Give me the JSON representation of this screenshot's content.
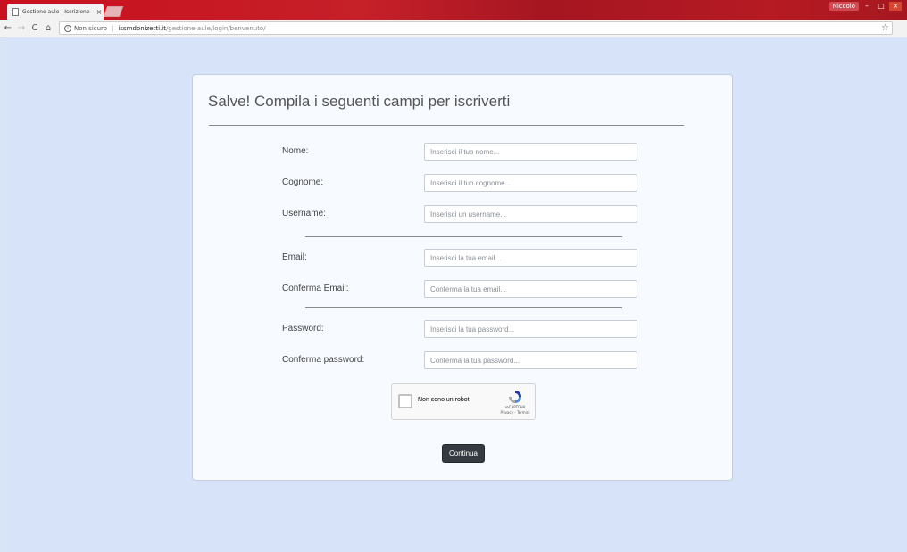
{
  "browser": {
    "tab_title": "Gestione aule | Iscrizione",
    "tab_close": "×",
    "user_name": "Niccolo",
    "win_minimize": "–",
    "win_maximize": "□",
    "win_close": "×",
    "back_icon": "←",
    "forward_icon": "→",
    "reload_icon": "C",
    "home_icon": "⌂",
    "info_icon": "i",
    "not_secure": "Non sicuro",
    "url_host": "issmdonizetti.it",
    "url_path": "/gestione-aule/login/benvenuto/",
    "star_icon": "☆"
  },
  "form": {
    "title": "Salve! Compila i seguenti campi per iscriverti",
    "fields": [
      {
        "label": "Nome:",
        "placeholder": "Inserisci il tuo nome..."
      },
      {
        "label": "Cognome:",
        "placeholder": "Inserisci il tuo cognome..."
      },
      {
        "label": "Username:",
        "placeholder": "Inserisci un username..."
      },
      {
        "label": "Email:",
        "placeholder": "Inserisci la tua email..."
      },
      {
        "label": "Conferma Email:",
        "placeholder": "Conferma la tua email..."
      },
      {
        "label": "Password:",
        "placeholder": "Inserisci la tua password..."
      },
      {
        "label": "Conferma password:",
        "placeholder": "Conferma la tua password..."
      }
    ],
    "recaptcha": {
      "label": "Non sono un robot",
      "brand": "reCAPTCHA",
      "links": "Privacy - Termini"
    },
    "submit_label": "Continua"
  },
  "colors": {
    "page_bg": "#d6e3f8",
    "card_bg": "#f7faff",
    "button_bg": "#343a40",
    "chrome_titlebar": "#c8101e"
  }
}
